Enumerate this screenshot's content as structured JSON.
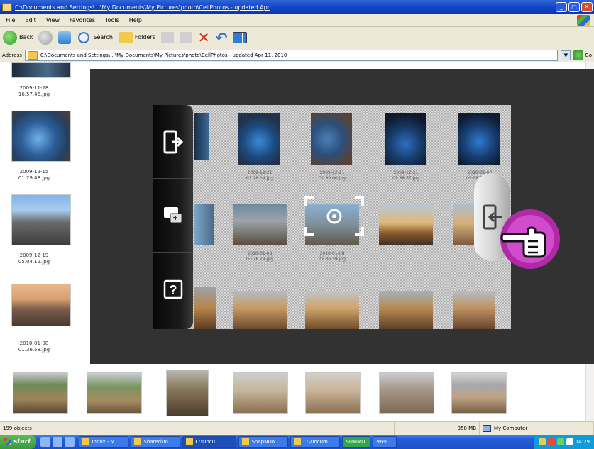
{
  "window": {
    "title": "C:\\Documents and Settings\\...\\My Documents\\My Pictures\\photo\\CellPhotos - updated Apr",
    "min": "_",
    "max": "□",
    "close": "✕"
  },
  "menu": [
    "File",
    "Edit",
    "View",
    "Favorites",
    "Tools",
    "Help"
  ],
  "toolbar": {
    "back": "Back",
    "search": "Search",
    "folders": "Folders"
  },
  "address": {
    "label": "Address",
    "value": "C:\\Documents and Settings\\...\\My Documents\\My Pictures\\photo\\CellPhotos - updated Apr 11, 2010",
    "go": "Go"
  },
  "files": [
    {
      "caption": "2009-11-28\n16.57.46.jpg"
    },
    {
      "caption": "2009-12-15\n01.29.48.jpg"
    },
    {
      "caption": "2009-12-19\n05.04.12.jpg"
    },
    {
      "caption": "2010-01-08\n01.36.58.jpg"
    }
  ],
  "stage_captions": [
    "2009-12-21\n01.28.14.jpg",
    "2009-12-21\n01.30.00.jpg",
    "2009-12-21\n01.38.57.jpg",
    "2010-01-03\n03.06.11.jpg",
    "2010-01-08\n03.26.29.jpg",
    "2010-01-08\n01.36.59.jpg"
  ],
  "overlay": {
    "left_buttons": [
      "send-to-device",
      "sync-screens",
      "help"
    ],
    "help_glyph": "?"
  },
  "status": {
    "objects": "199 objects",
    "size": "358 MB",
    "location": "My Computer"
  },
  "taskbar": {
    "start": "start",
    "tasks": [
      "Inbox - M...",
      "SharedDo...",
      "C:\\Docu...",
      "SnapNDo...",
      "C:\\Docum...",
      "SUMMIT",
      "96%"
    ],
    "clock": "14:29"
  }
}
